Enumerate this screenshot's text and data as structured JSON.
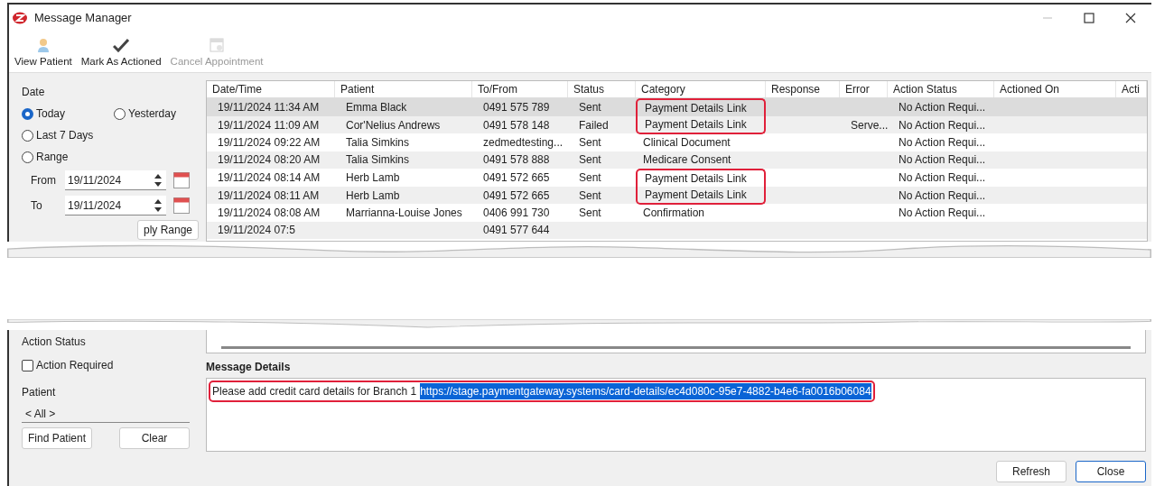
{
  "window": {
    "title": "Message Manager"
  },
  "toolbar": [
    {
      "label": "View Patient",
      "kind": "person",
      "disabled": false
    },
    {
      "label": "Mark As Actioned",
      "kind": "check",
      "disabled": false
    },
    {
      "label": "Cancel Appointment",
      "kind": "calendar",
      "disabled": true
    }
  ],
  "date_filter": {
    "label": "Date",
    "options": [
      {
        "label": "Today",
        "selected": true
      },
      {
        "label": "Yesterday",
        "selected": false
      },
      {
        "label": "Last 7 Days",
        "selected": false
      },
      {
        "label": "Range",
        "selected": false
      }
    ],
    "from": {
      "label": "From",
      "value": "19/11/2024"
    },
    "to": {
      "label": "To",
      "value": "19/11/2024"
    },
    "apply_button": "ply Range"
  },
  "table": {
    "columns": [
      "Date/Time",
      "Patient",
      "To/From",
      "Status",
      "Category",
      "Response",
      "Error",
      "Action Status",
      "Actioned On",
      "Acti"
    ],
    "rows": [
      {
        "cells": [
          "19/11/2024 11:34 AM",
          "Emma Black",
          "0491 575 789",
          "Sent",
          "Payment Details Link",
          "",
          "",
          "No Action Requi...",
          "",
          ""
        ],
        "selected": true,
        "highlighted": true
      },
      {
        "cells": [
          "19/11/2024 11:09 AM",
          "Cor'Nelius Andrews",
          "0491 578 148",
          "Failed",
          "Payment Details Link",
          "",
          "Serve...",
          "No Action Requi...",
          "",
          ""
        ],
        "selected": false,
        "highlighted": true
      },
      {
        "cells": [
          "19/11/2024 09:22 AM",
          "Talia Simkins",
          "zedmedtesting...",
          "Sent",
          "Clinical Document",
          "",
          "",
          "No Action Requi...",
          "",
          ""
        ],
        "selected": false,
        "highlighted": false
      },
      {
        "cells": [
          "19/11/2024 08:20 AM",
          "Talia Simkins",
          "0491 578 888",
          "Sent",
          "Medicare Consent",
          "",
          "",
          "No Action Requi...",
          "",
          ""
        ],
        "selected": false,
        "highlighted": false
      },
      {
        "cells": [
          "19/11/2024 08:14 AM",
          "Herb Lamb",
          "0491 572 665",
          "Sent",
          "Payment Details Link",
          "",
          "",
          "No Action Requi...",
          "",
          ""
        ],
        "selected": false,
        "highlighted": true
      },
      {
        "cells": [
          "19/11/2024 08:11 AM",
          "Herb Lamb",
          "0491 572 665",
          "Sent",
          "Payment Details Link",
          "",
          "",
          "No Action Requi...",
          "",
          ""
        ],
        "selected": false,
        "highlighted": true
      },
      {
        "cells": [
          "19/11/2024 08:08 AM",
          "Marrianna-Louise Jones",
          "0406 991 730",
          "Sent",
          "Confirmation",
          "",
          "",
          "No Action Requi...",
          "",
          ""
        ],
        "selected": false,
        "highlighted": false
      },
      {
        "cells": [
          "19/11/2024 07:5",
          "",
          "0491 577 644",
          "",
          "",
          "",
          "",
          "",
          "",
          ""
        ],
        "selected": false,
        "highlighted": false
      }
    ]
  },
  "action_status": {
    "label": "Action Status",
    "checkbox": {
      "label": "Action Required",
      "checked": false
    }
  },
  "patient_filter": {
    "label": "Patient",
    "value": "< All >",
    "buttons": [
      "Find Patient",
      "Clear"
    ]
  },
  "message_details": {
    "label": "Message Details",
    "text": "Please add credit card details for Branch 1",
    "link": "https://stage.paymentgateway.systems/card-details/ec4d080c-95e7-4882-b4e6-fa0016b06084",
    "link_selected": true,
    "highlighted": true
  },
  "buttons": [
    {
      "label": "Refresh",
      "default": false
    },
    {
      "label": "Close",
      "default": true
    }
  ]
}
